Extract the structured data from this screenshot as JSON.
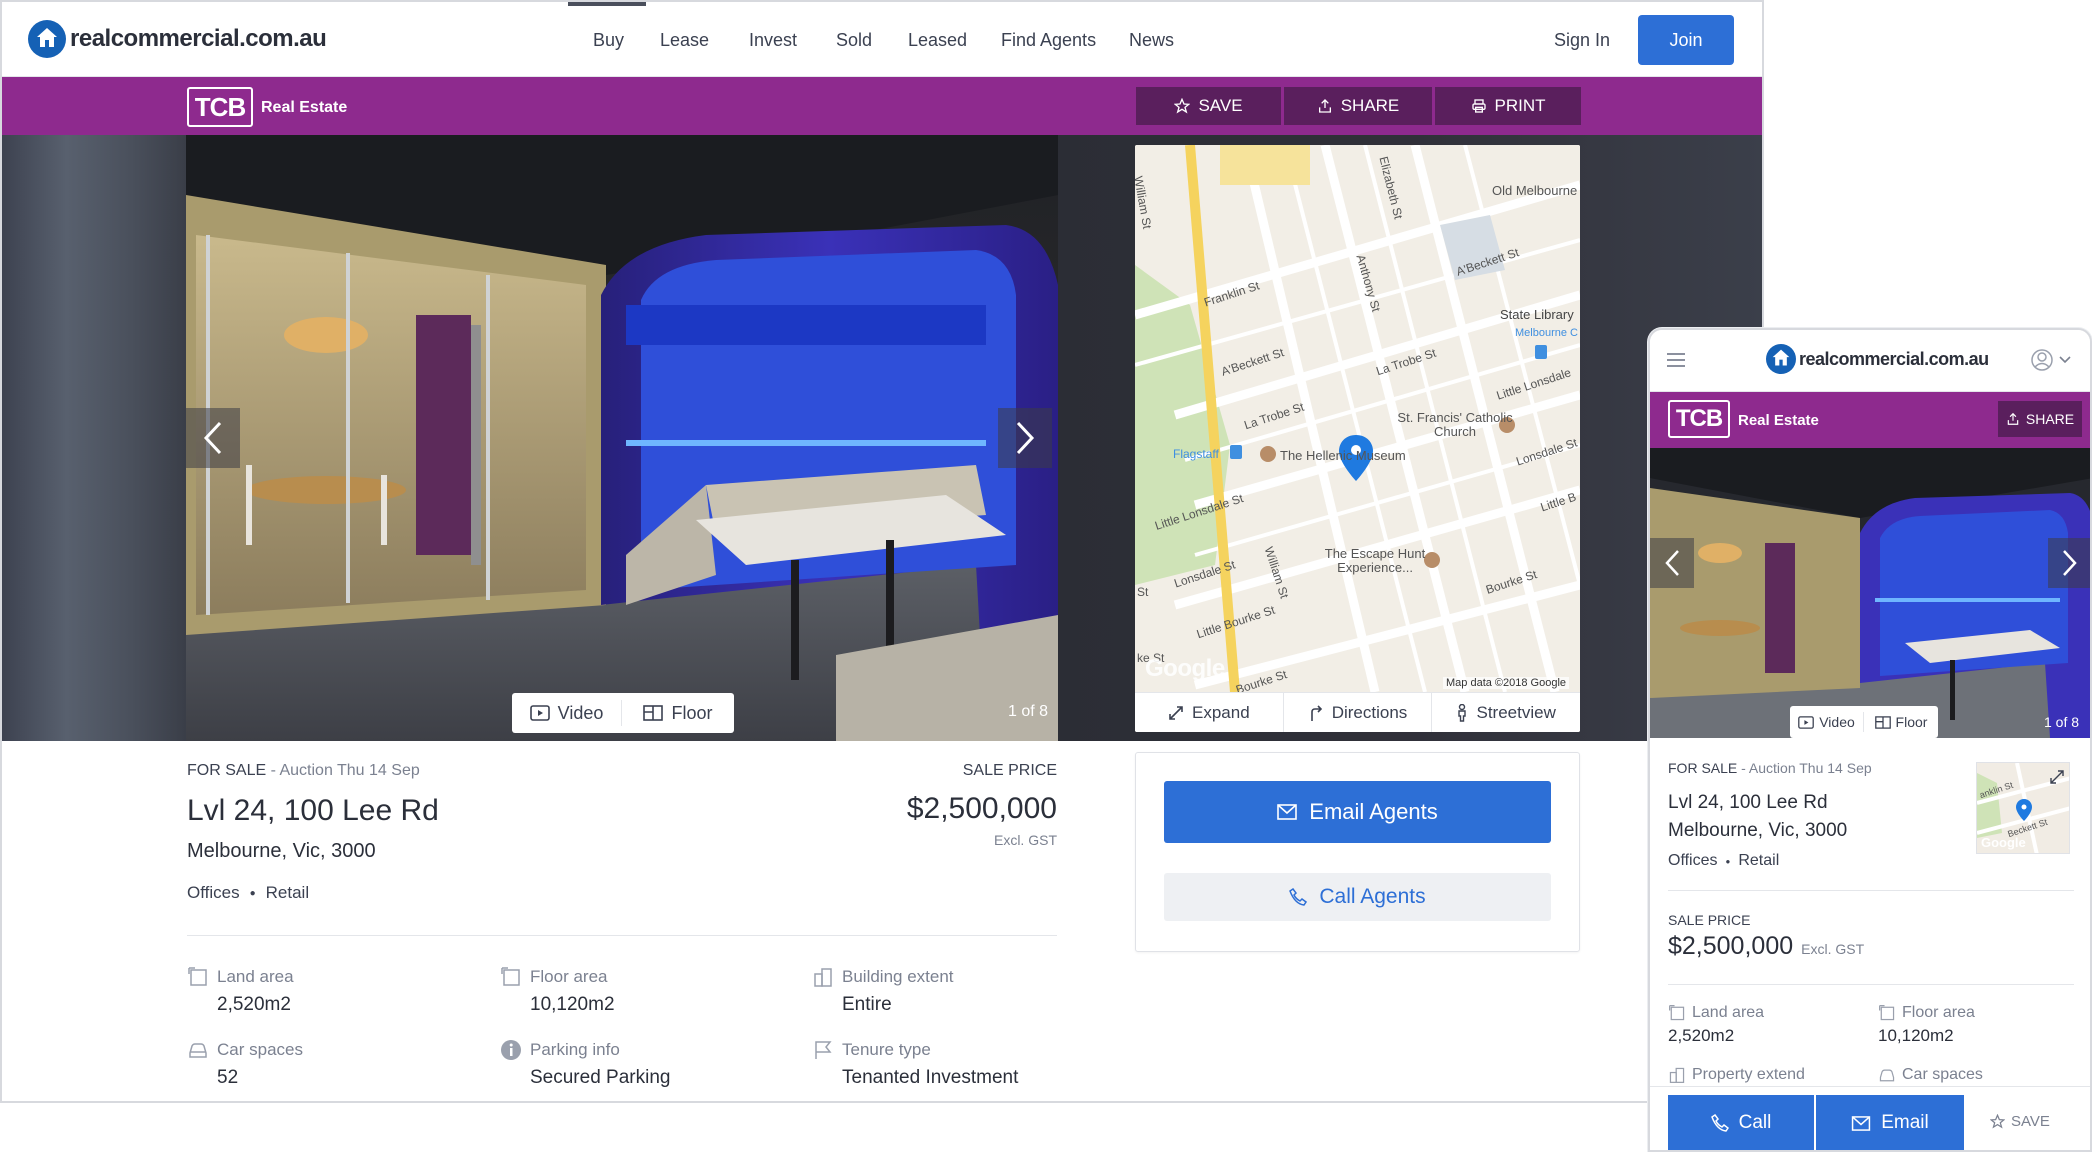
{
  "site": {
    "logo_text": "realcommercial.com.au"
  },
  "nav": {
    "items": [
      "Buy",
      "Lease",
      "Invest",
      "Sold",
      "Leased",
      "Find Agents",
      "News"
    ],
    "active": "Buy",
    "sign_in": "Sign In",
    "join": "Join"
  },
  "agency": {
    "logo": "TCB",
    "name": "Real Estate"
  },
  "actions": {
    "save": "SAVE",
    "share": "SHARE",
    "print": "PRINT"
  },
  "gallery": {
    "video": "Video",
    "floor": "Floor",
    "counter": "1 of 8"
  },
  "map": {
    "labels": [
      "Elizabeth St",
      "Old Melbourne",
      "William St",
      "Franklin St",
      "Anthony St",
      "A'Beckett St",
      "State Library",
      "Melbourne C",
      "A'Beckett St",
      "La Trobe St",
      "Little Lonsdale",
      "La Trobe St",
      "St. Francis' Catholic Church",
      "Flagstaff",
      "The Hellenic Museum",
      "Lonsdale St",
      "Little Lonsdale St",
      "Little B",
      "The Escape Hunt Experience...",
      "Lonsdale St",
      "William St",
      "Bourke St",
      "Little Bourke St",
      "Bourke St",
      "St",
      "ke St"
    ],
    "attribution": "Map data ©2018 Google",
    "google": "Google",
    "expand": "Expand",
    "directions": "Directions",
    "streetview": "Streetview"
  },
  "listing": {
    "status": "FOR SALE",
    "auction": "- Auction Thu 14 Sep",
    "address_line1": "Lvl 24, 100 Lee Rd",
    "address_line2": "Melbourne, Vic, 3000",
    "type1": "Offices",
    "type2": "Retail",
    "price_label": "SALE PRICE",
    "price": "$2,500,000",
    "price_note": "Excl. GST"
  },
  "contact": {
    "email": "Email Agents",
    "call": "Call Agents"
  },
  "features": [
    {
      "label": "Land area",
      "value": "2,520m2"
    },
    {
      "label": "Floor area",
      "value": "10,120m2"
    },
    {
      "label": "Building extent",
      "value": "Entire"
    },
    {
      "label": "Car spaces",
      "value": "52"
    },
    {
      "label": "Parking info",
      "value": "Secured Parking"
    },
    {
      "label": "Tenure type",
      "value": "Tenanted Investment"
    }
  ],
  "mobile": {
    "share": "SHARE",
    "video": "Video",
    "floor": "Floor",
    "counter": "1 of 8",
    "status": "FOR SALE",
    "auction": "- Auction Thu 14 Sep",
    "address_line1": "Lvl 24, 100 Lee Rd",
    "address_line2": "Melbourne, Vic, 3000",
    "type1": "Offices",
    "type2": "Retail",
    "price_label": "SALE PRICE",
    "price": "$2,500,000",
    "price_note": "Excl. GST",
    "map_labels": [
      "anklin St",
      "Beckett St",
      "Google"
    ],
    "features": [
      {
        "label": "Land area",
        "value": "2,520m2"
      },
      {
        "label": "Floor area",
        "value": "10,120m2"
      },
      {
        "label": "Property extend",
        "value": ""
      },
      {
        "label": "Car spaces",
        "value": ""
      }
    ],
    "call": "Call",
    "email": "Email",
    "save": "SAVE"
  },
  "colors": {
    "brand_purple": "#8e2a8e",
    "primary_blue": "#2d6fd6",
    "logo_blue": "#1561b5"
  }
}
